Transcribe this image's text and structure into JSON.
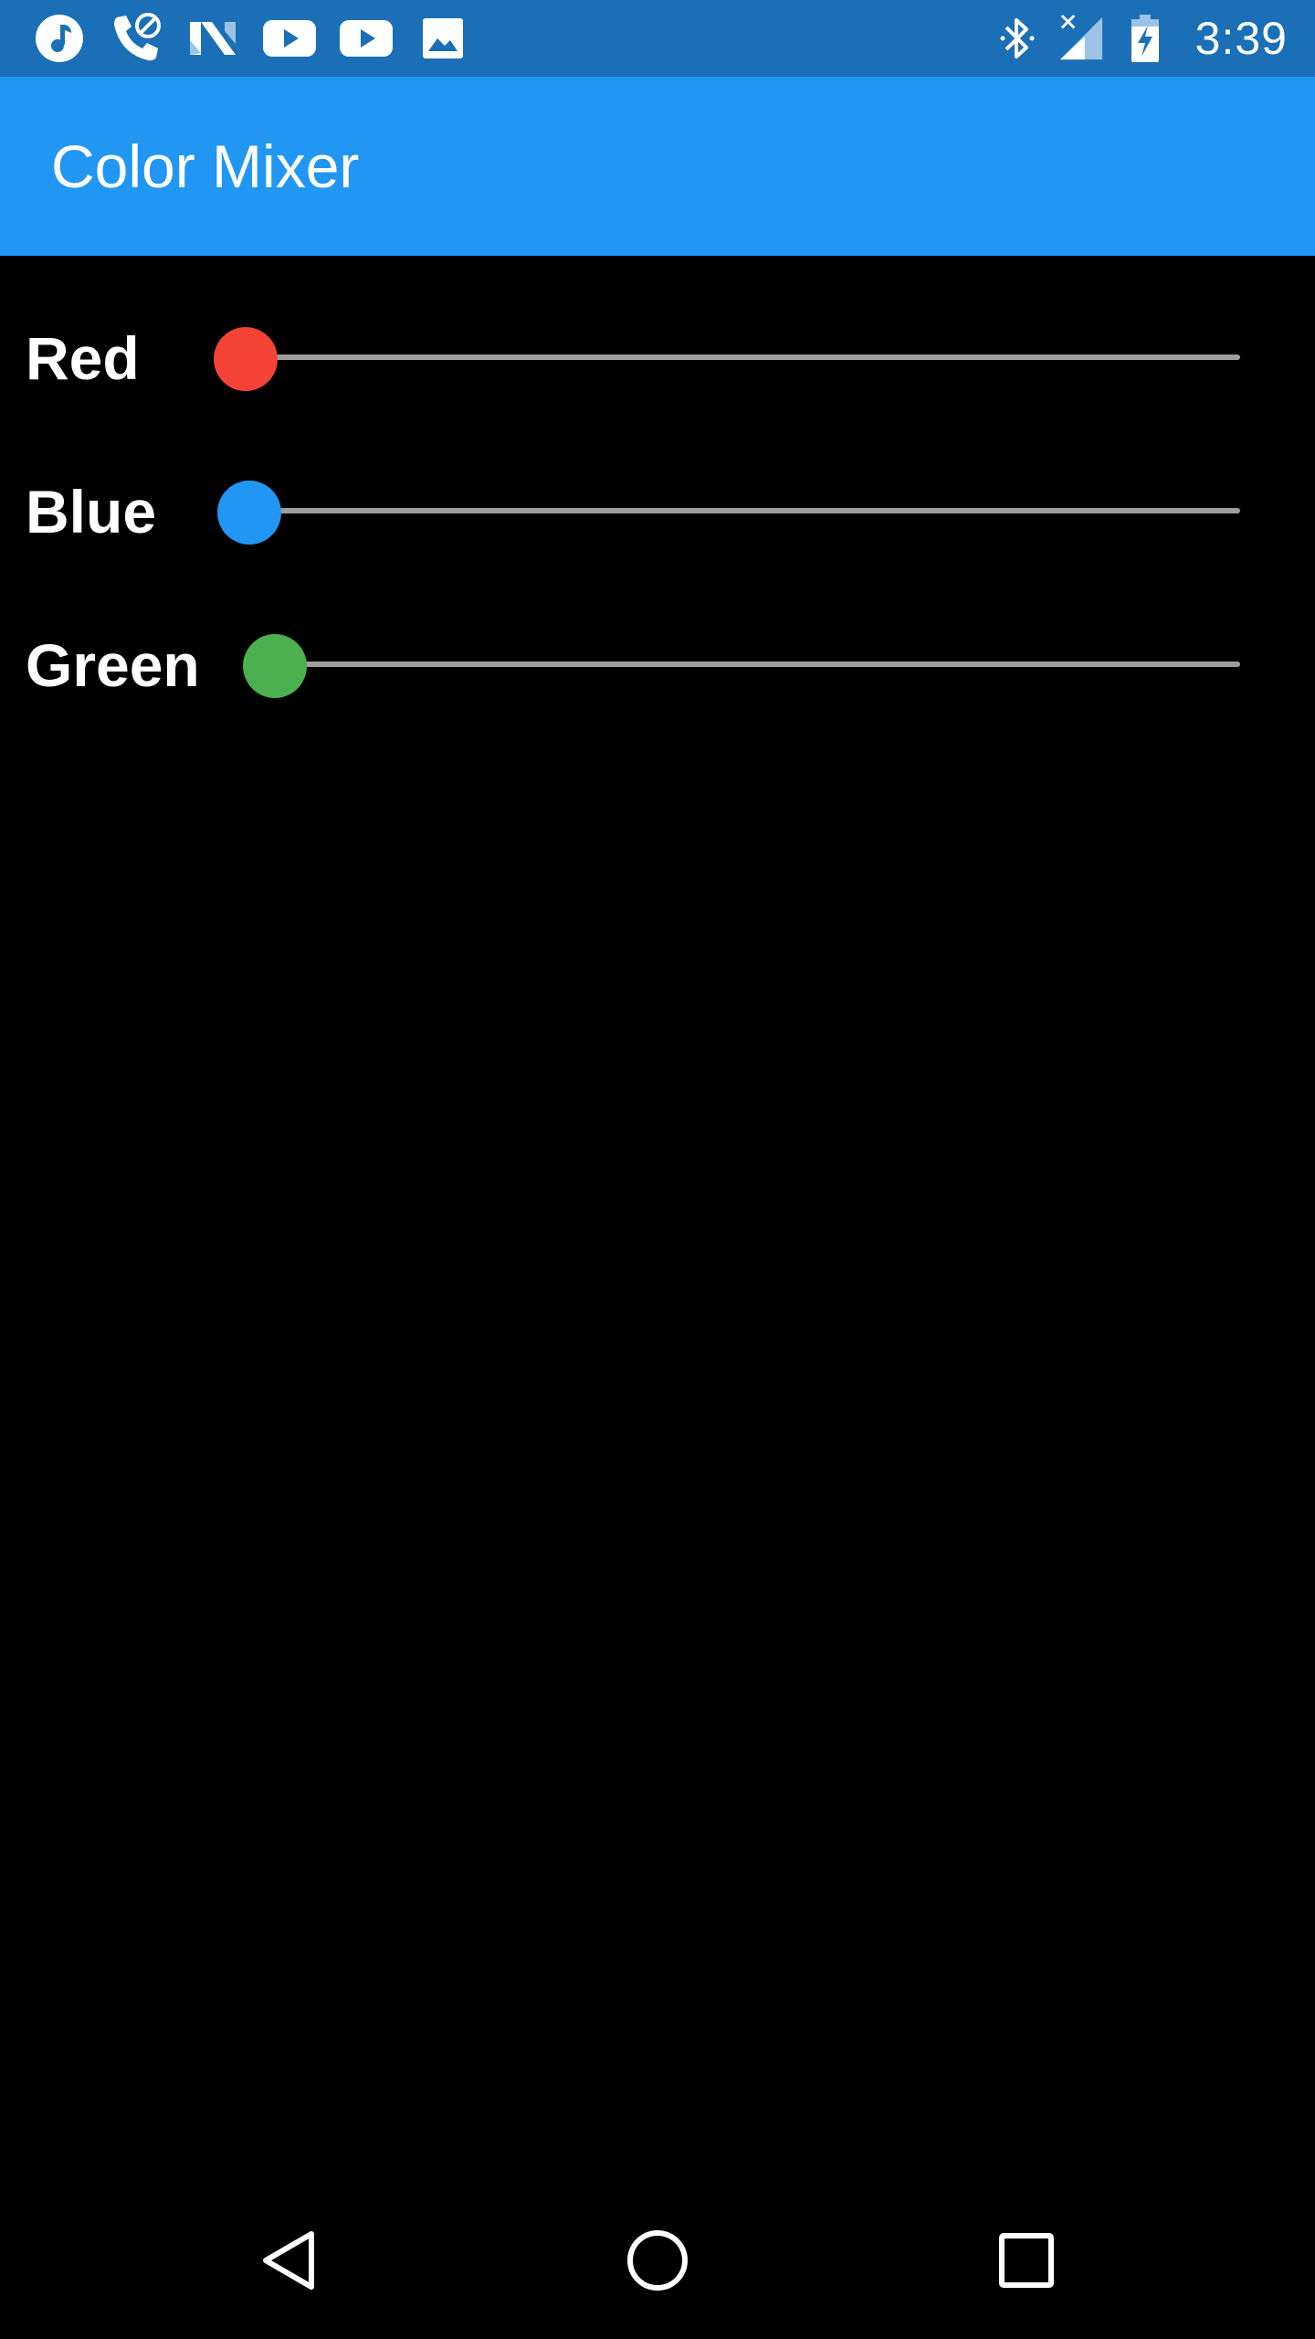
{
  "status_bar": {
    "notification_icons": [
      "music-note-icon",
      "phone-blocked-icon",
      "n-logo-icon",
      "youtube-icon",
      "youtube-icon",
      "image-icon"
    ],
    "system_icons": [
      "bluetooth-icon",
      "cell-signal-no-service-icon",
      "battery-charging-icon"
    ],
    "time": "3:39",
    "background_color": "#1a6fb6"
  },
  "app_bar": {
    "title": "Color Mixer",
    "background_color": "#2196f3"
  },
  "sliders": [
    {
      "label": "Red",
      "value": 0,
      "thumb_color": "#f44336"
    },
    {
      "label": "Blue",
      "value": 0,
      "thumb_color": "#2196f3"
    },
    {
      "label": "Green",
      "value": 0,
      "thumb_color": "#4caf50"
    }
  ],
  "nav_bar": {
    "buttons": [
      "back-icon",
      "home-icon",
      "recents-icon"
    ]
  },
  "track_color": "#9e9e9e",
  "background_color": "#000000"
}
